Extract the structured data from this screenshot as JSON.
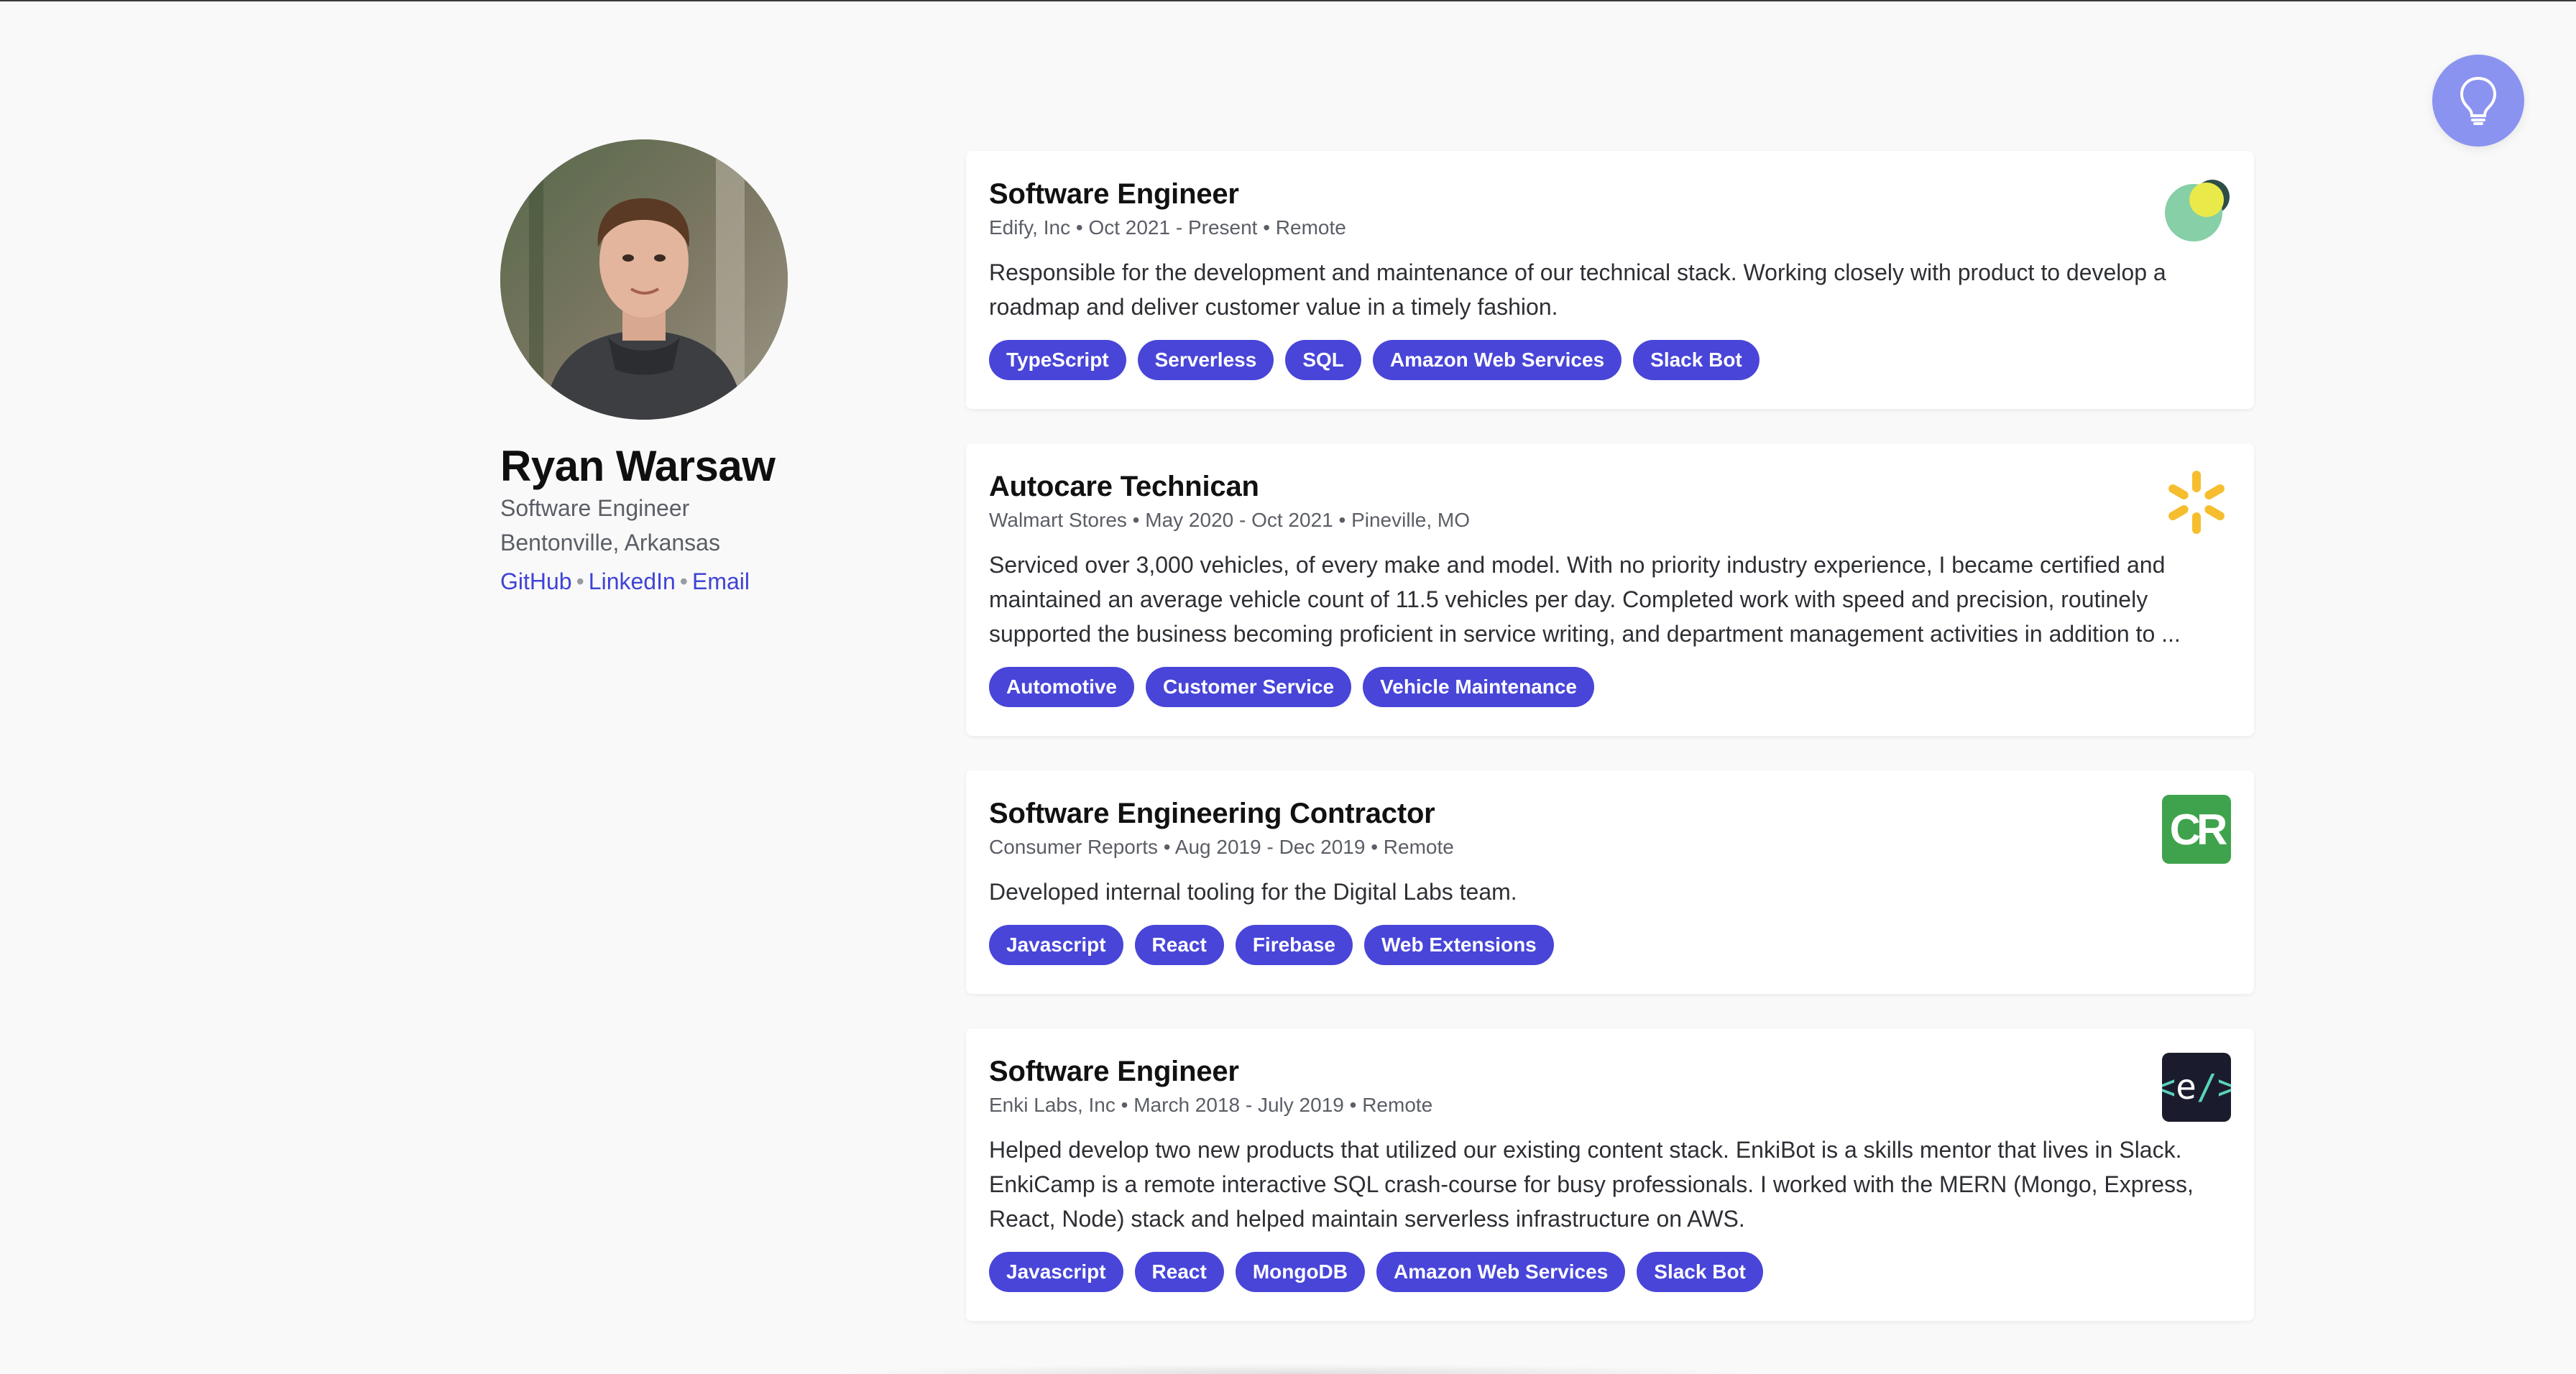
{
  "profile": {
    "name": "Ryan Warsaw",
    "title": "Software Engineer",
    "location": "Bentonville, Arkansas",
    "links": {
      "github": "GitHub",
      "linkedin": "LinkedIn",
      "email": "Email",
      "separator": "•"
    }
  },
  "icons": {
    "theme_toggle": "lightbulb-icon",
    "avatar": "profile-photo"
  },
  "colors": {
    "accent": "#4845d8",
    "link": "#3f43d6",
    "toggle_bg": "#8b93f0",
    "background": "#f9f9f9"
  },
  "experience": [
    {
      "role": "Software Engineer",
      "subtitle": "Edify, Inc • Oct 2021 - Present • Remote",
      "description": "Responsible for the development and maintenance of our technical stack. Working closely with product to develop a roadmap and deliver customer value in a timely fashion.",
      "tags": [
        "TypeScript",
        "Serverless",
        "SQL",
        "Amazon Web Services",
        "Slack Bot"
      ],
      "logo": "edify-logo-icon"
    },
    {
      "role": "Autocare Technican",
      "subtitle": "Walmart Stores • May 2020 - Oct 2021 • Pineville, MO",
      "description": "Serviced over 3,000 vehicles, of every make and model. With no priority industry experience, I became certified and maintained an average vehicle count of 11.5 vehicles per day. Completed work with speed and precision, routinely supported the business becoming proficient in service writing, and department management activities in addition to ...",
      "tags": [
        "Automotive",
        "Customer Service",
        "Vehicle Maintenance"
      ],
      "logo": "walmart-spark-icon"
    },
    {
      "role": "Software Engineering Contractor",
      "subtitle": "Consumer Reports • Aug 2019 - Dec 2019 • Remote",
      "description": "Developed internal tooling for the Digital Labs team.",
      "tags": [
        "Javascript",
        "React",
        "Firebase",
        "Web Extensions"
      ],
      "logo": "consumer-reports-logo-icon",
      "logo_text": "CR"
    },
    {
      "role": "Software Engineer",
      "subtitle": "Enki Labs, Inc • March 2018 - July 2019 • Remote",
      "description": "Helped develop two new products that utilized our existing content stack. EnkiBot is a skills mentor that lives in Slack. EnkiCamp is a remote interactive SQL crash-course for busy professionals. I worked with the MERN (Mongo, Express, React, Node) stack and helped maintain serverless infrastructure on AWS.",
      "tags": [
        "Javascript",
        "React",
        "MongoDB",
        "Amazon Web Services",
        "Slack Bot"
      ],
      "logo": "enki-logo-icon",
      "logo_text": {
        "left": "<",
        "mid": "e",
        "right": "/>"
      }
    }
  ]
}
